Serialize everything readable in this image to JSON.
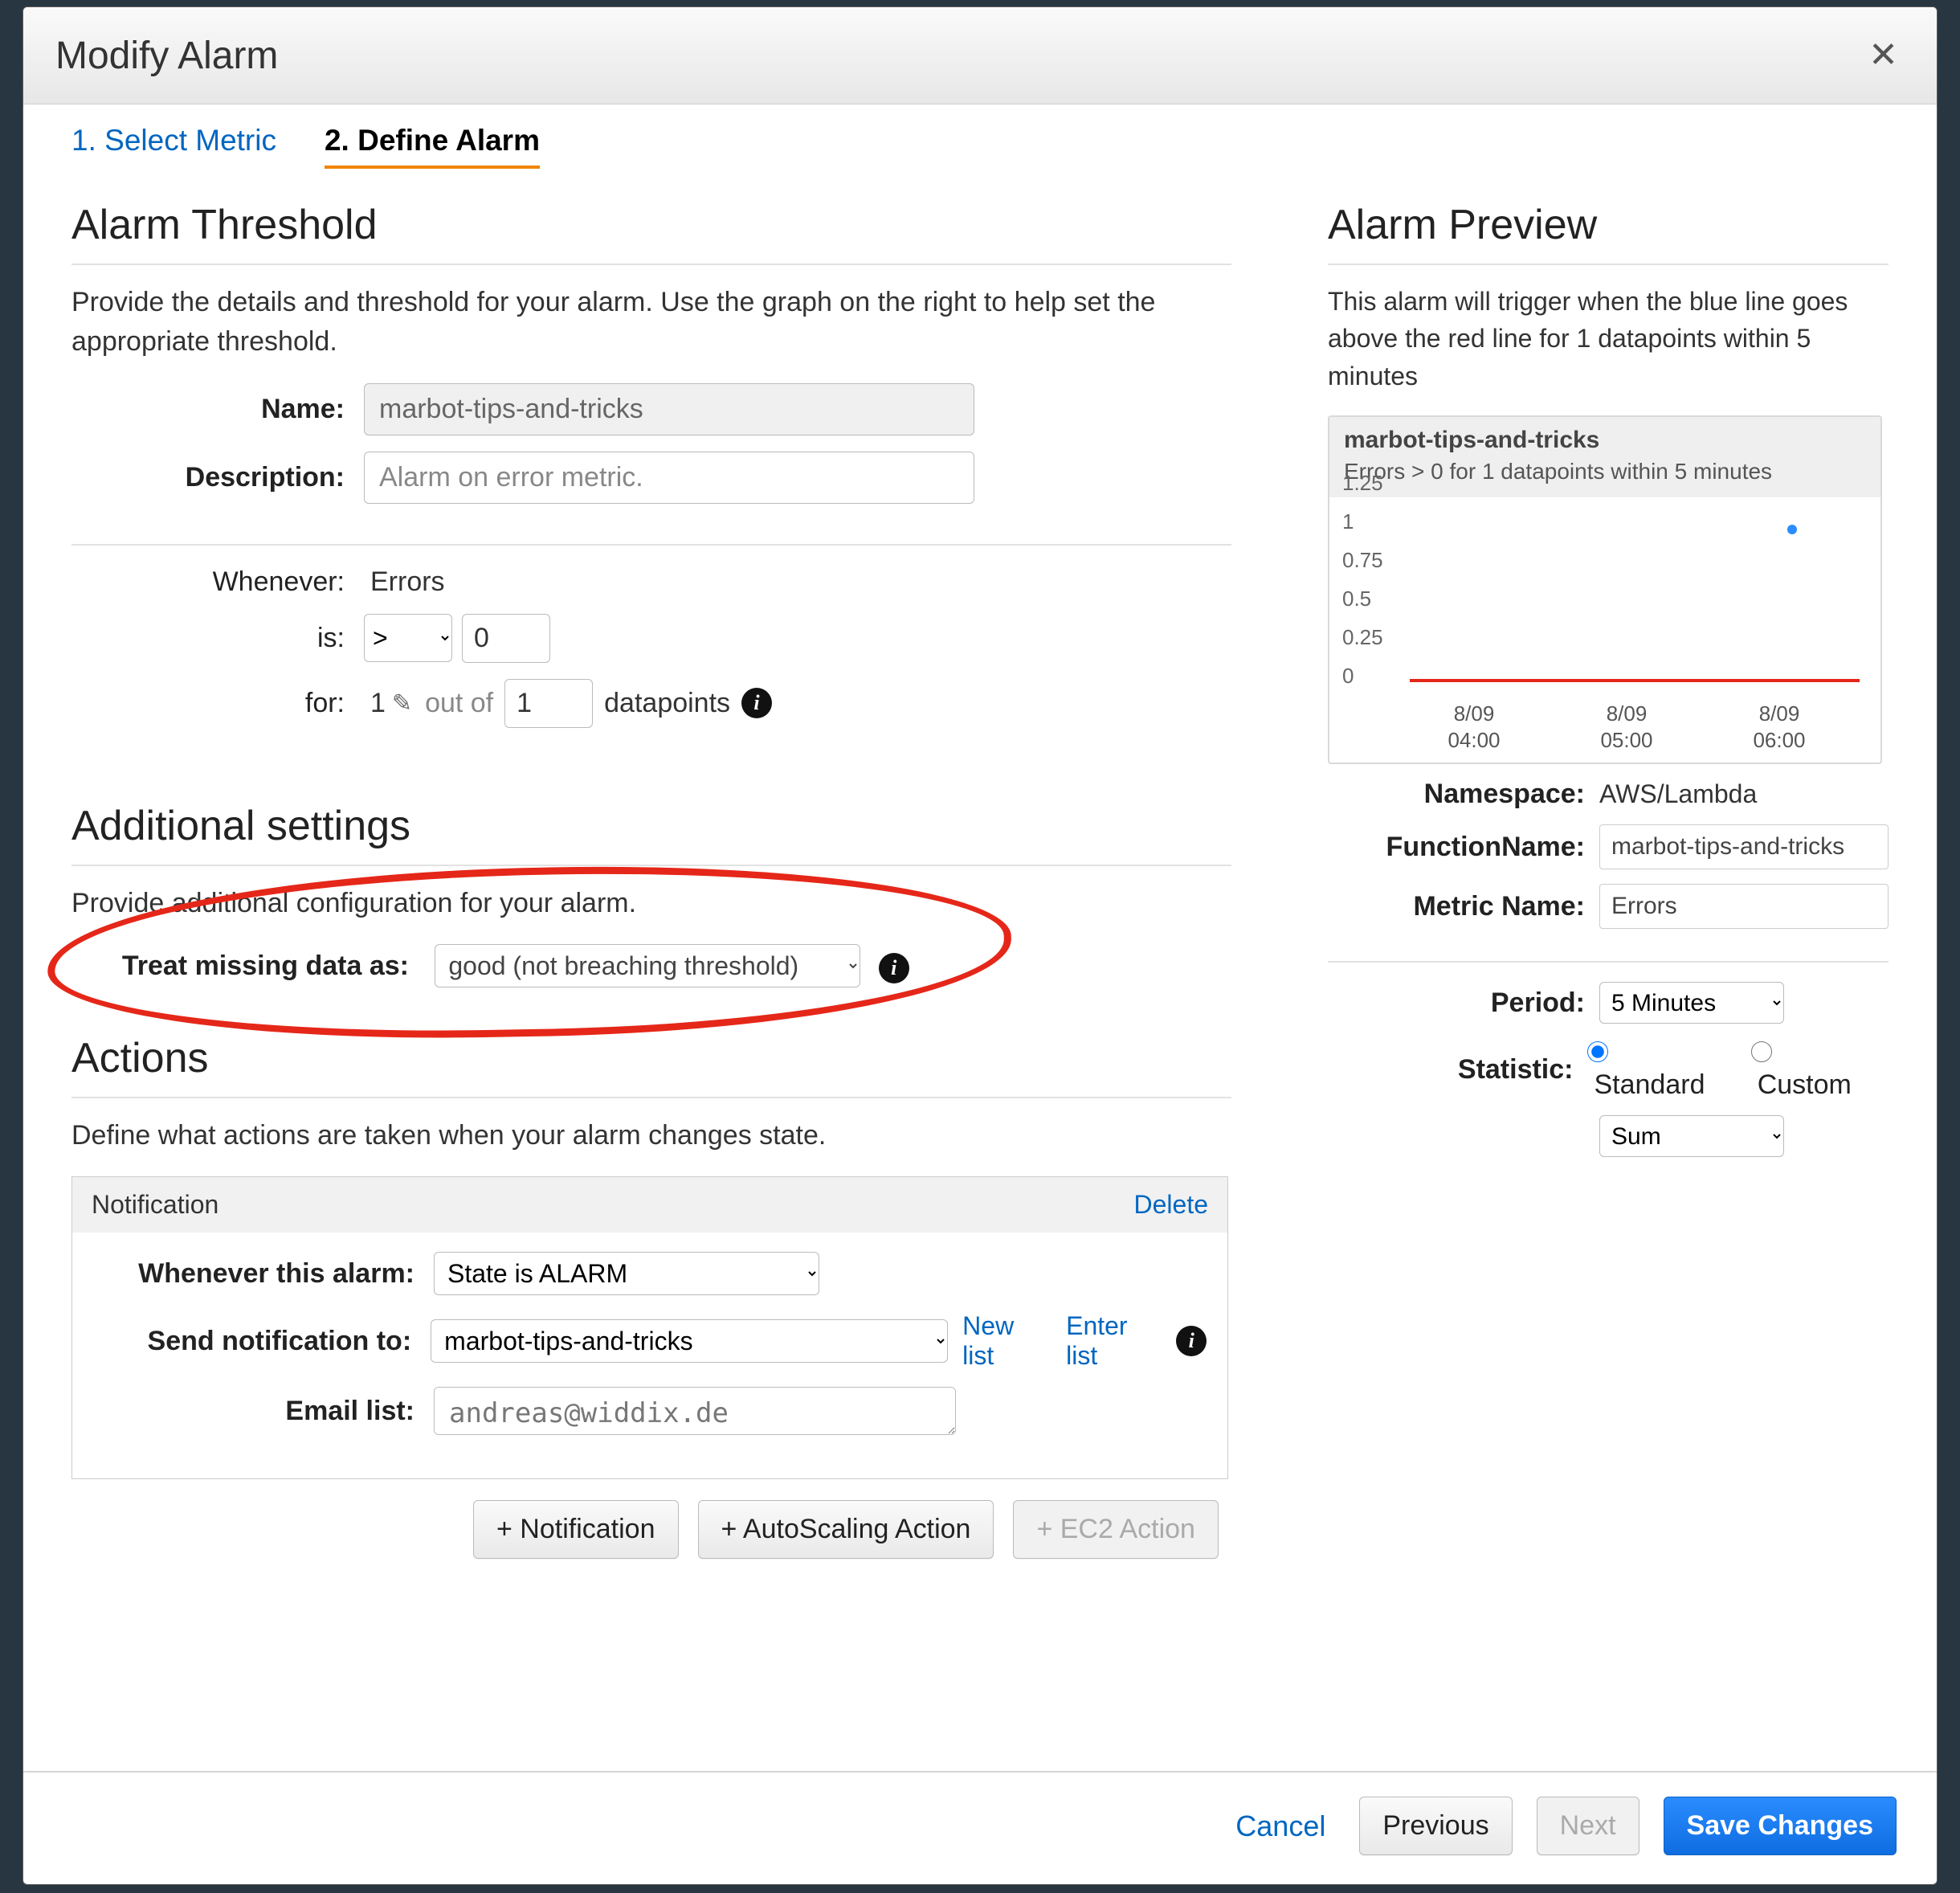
{
  "modal": {
    "title": "Modify Alarm"
  },
  "tabs": {
    "step1": "1. Select Metric",
    "step2": "2. Define Alarm"
  },
  "threshold": {
    "heading": "Alarm Threshold",
    "help": "Provide the details and threshold for your alarm. Use the graph on the right to help set the appropriate threshold.",
    "name_label": "Name:",
    "name_value": "marbot-tips-and-tricks",
    "desc_label": "Description:",
    "desc_value": "Alarm on error metric.",
    "whenever_label": "Whenever:",
    "whenever_value": "Errors",
    "is_label": "is:",
    "cmp": ">",
    "cmp_value": "0",
    "for_label": "for:",
    "for_n": "1",
    "out_of": "out of",
    "for_m": "1",
    "datapoints": "datapoints"
  },
  "additional": {
    "heading": "Additional settings",
    "help": "Provide additional configuration for your alarm.",
    "missing_label": "Treat missing data as:",
    "missing_value": "good (not breaching threshold)"
  },
  "actions": {
    "heading": "Actions",
    "help": "Define what actions are taken when your alarm changes state.",
    "panel_title": "Notification",
    "delete": "Delete",
    "whenever_label": "Whenever this alarm:",
    "state_value": "State is ALARM",
    "send_label": "Send notification to:",
    "sns_value": "marbot-tips-and-tricks",
    "new_list": "New list",
    "enter_list": "Enter list",
    "email_label": "Email list:",
    "email_value": "andreas@widdix.de",
    "add_notification": "+ Notification",
    "add_autoscaling": "+ AutoScaling Action",
    "add_ec2": "+ EC2 Action"
  },
  "preview": {
    "heading": "Alarm Preview",
    "help": "This alarm will trigger when the blue line goes above the red line for 1 datapoints within 5 minutes",
    "title": "marbot-tips-and-tricks",
    "sub": "Errors > 0 for 1 datapoints within 5 minutes",
    "namespace_label": "Namespace:",
    "namespace_value": "AWS/Lambda",
    "fn_label": "FunctionName:",
    "fn_value": "marbot-tips-and-tricks",
    "metric_label": "Metric Name:",
    "metric_value": "Errors",
    "period_label": "Period:",
    "period_value": "5 Minutes",
    "stat_label": "Statistic:",
    "stat_std": "Standard",
    "stat_custom": "Custom",
    "stat_value": "Sum"
  },
  "footer": {
    "cancel": "Cancel",
    "previous": "Previous",
    "next": "Next",
    "save": "Save Changes"
  },
  "chart_data": {
    "type": "line",
    "title": "marbot-tips-and-tricks",
    "ylabel": "",
    "xlabel": "",
    "ylim": [
      0,
      1.25
    ],
    "threshold": 0,
    "x_ticks": [
      "8/09 04:00",
      "8/09 05:00",
      "8/09 06:00"
    ],
    "y_ticks": [
      0,
      0.25,
      0.5,
      0.75,
      1,
      1.25
    ],
    "series": [
      {
        "name": "Errors",
        "color": "#2a8cff",
        "points": [
          {
            "x": "8/09 05:55",
            "y": 1
          }
        ]
      }
    ],
    "threshold_series": {
      "name": "threshold",
      "color": "#e52719",
      "y": 0
    }
  }
}
